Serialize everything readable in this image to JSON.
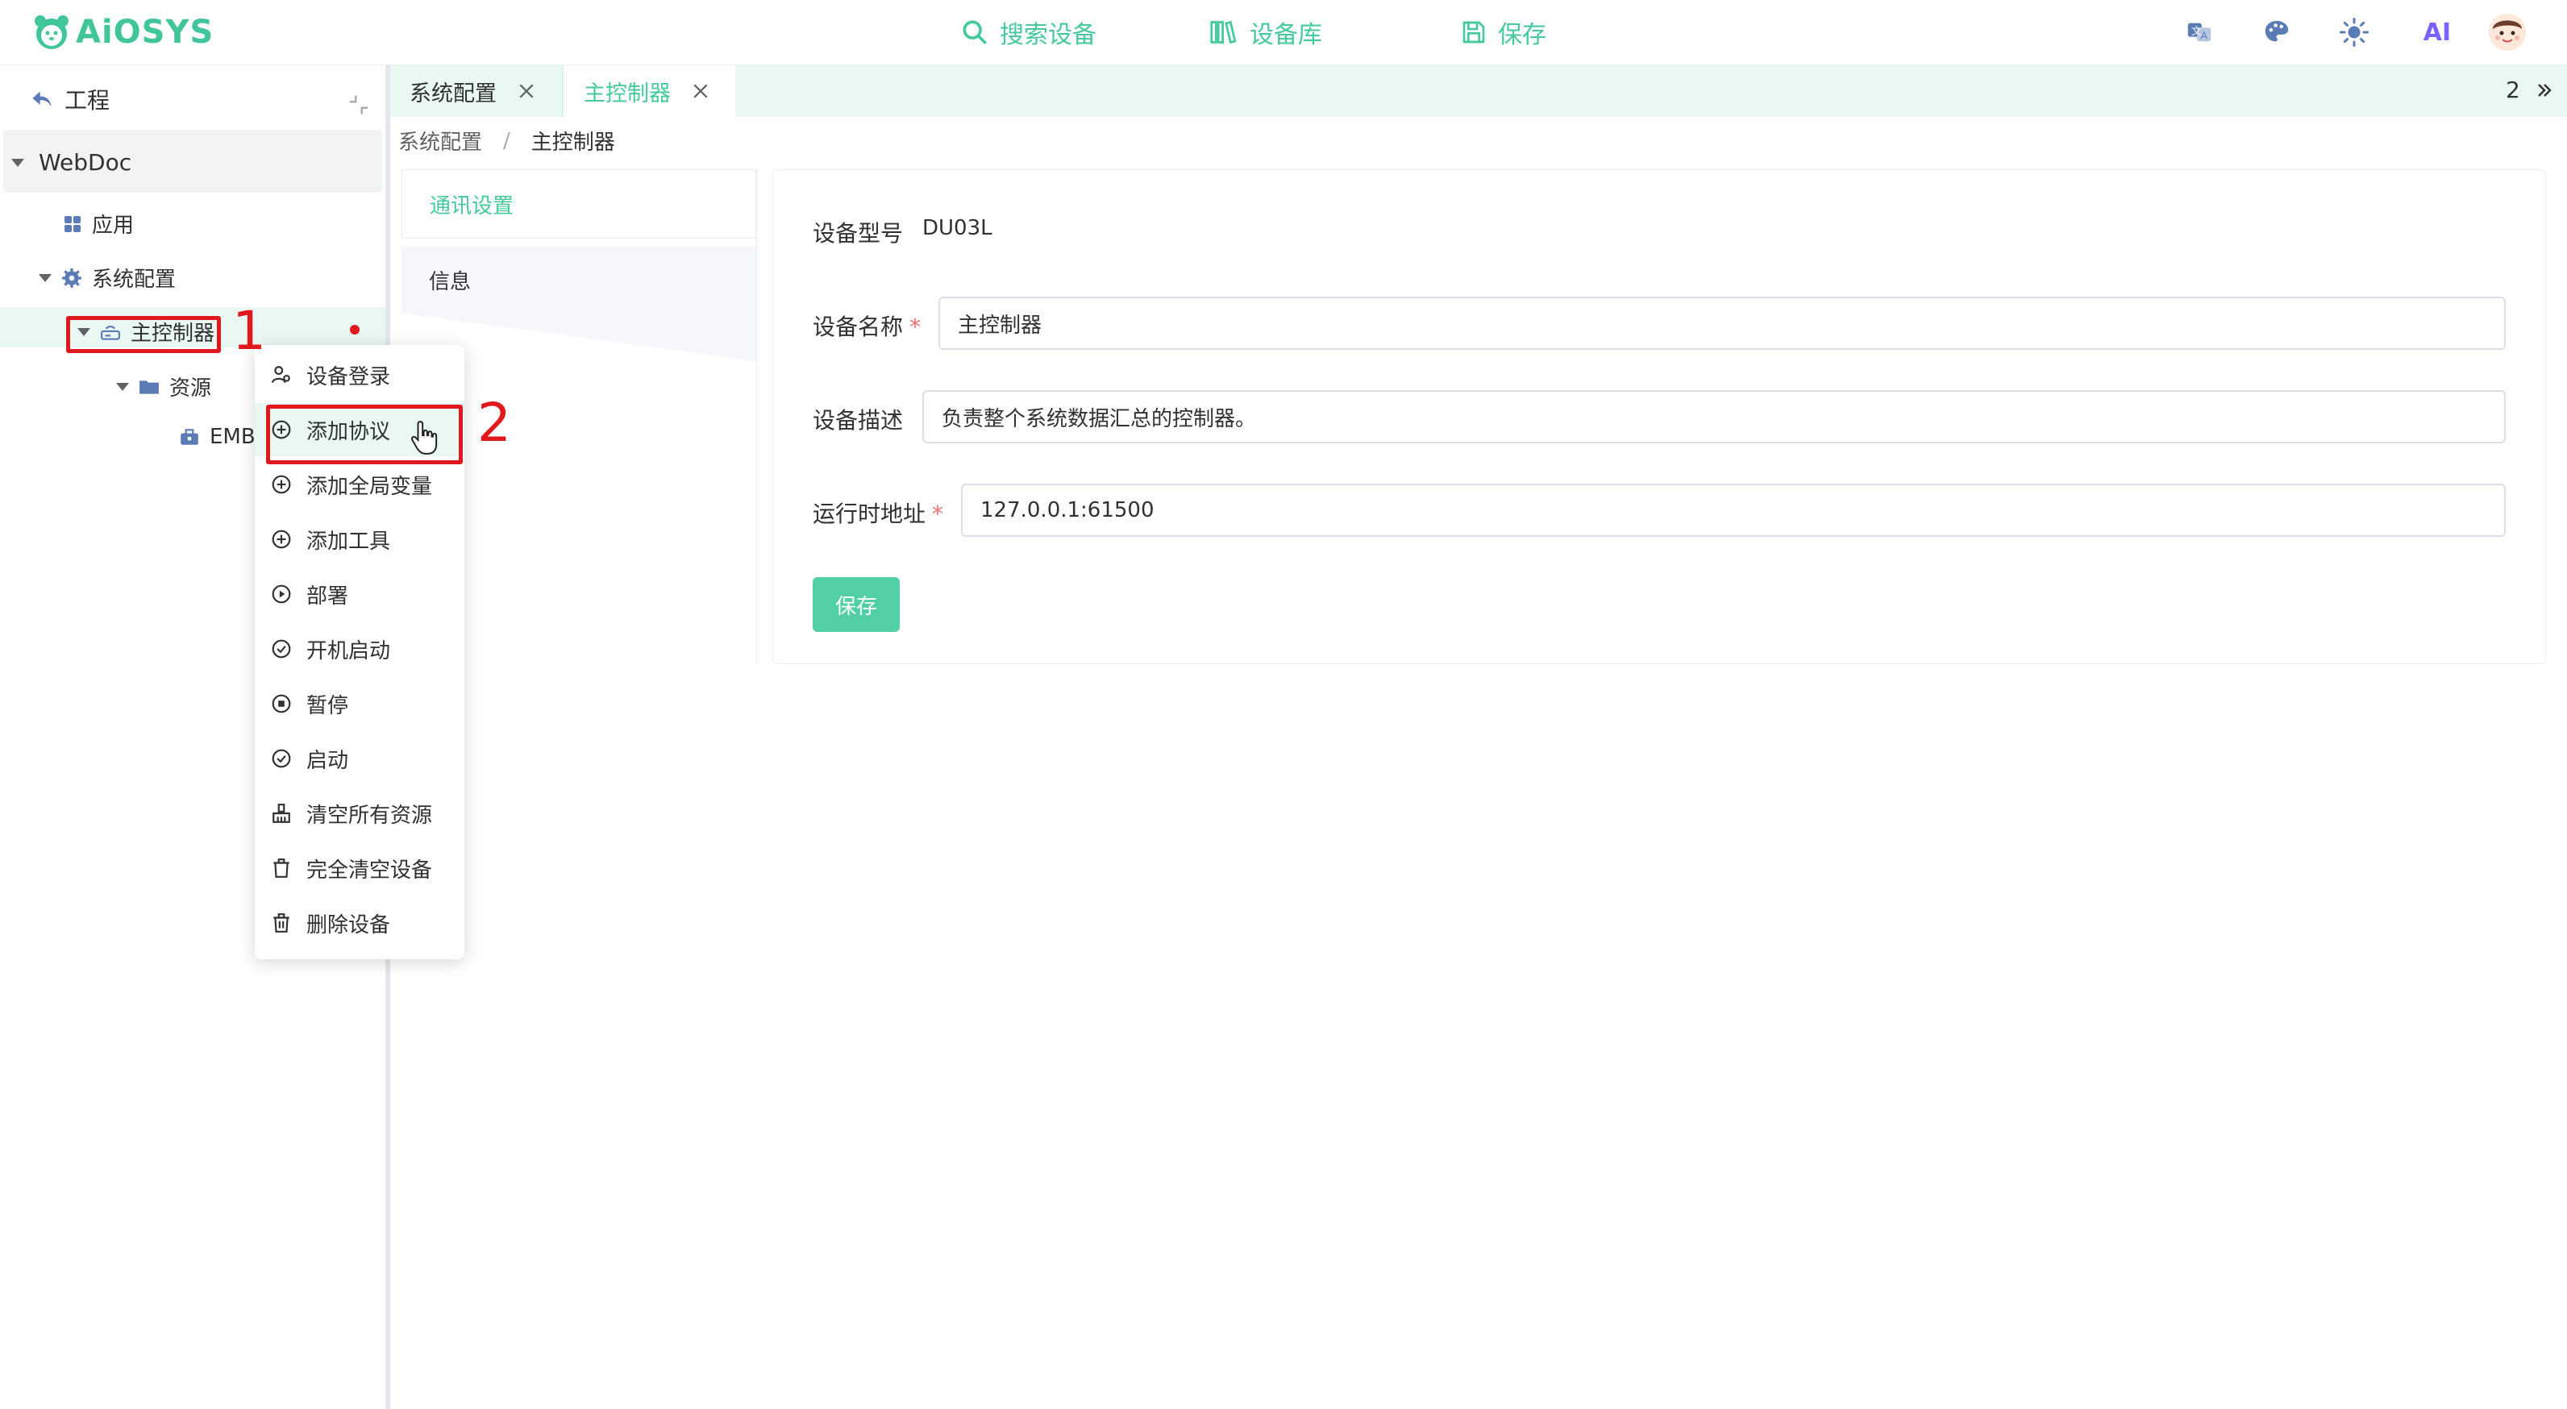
{
  "header": {
    "logo_text": "AiOSYS",
    "nav": [
      {
        "label": "搜索设备",
        "icon": "search-icon"
      },
      {
        "label": "设备库",
        "icon": "library-icon"
      },
      {
        "label": "保存",
        "icon": "save-icon"
      }
    ],
    "right_icons": [
      "translate-icon",
      "palette-icon",
      "sun-icon",
      "ai-icon",
      "avatar"
    ],
    "ai_label": "AI",
    "accent_color": "#46c99c"
  },
  "sidebar": {
    "back_label": "工程",
    "root": "WebDoc",
    "items": [
      {
        "label": "应用",
        "icon": "grid-icon"
      },
      {
        "label": "系统配置",
        "icon": "gear-icon"
      },
      {
        "label": "主控制器",
        "icon": "router-icon"
      },
      {
        "label": "资源",
        "icon": "folder-icon"
      },
      {
        "label": "EMB",
        "icon": "toolbox-icon"
      }
    ]
  },
  "tabs": {
    "items": [
      {
        "label": "系统配置",
        "active": false
      },
      {
        "label": "主控制器",
        "active": true
      }
    ],
    "count": "2"
  },
  "breadcrumb": {
    "items": [
      "系统配置",
      "主控制器"
    ],
    "separator": "/"
  },
  "inner_nav": {
    "items": [
      "通讯设置",
      "信息"
    ]
  },
  "form": {
    "model_label": "设备型号",
    "model_value": "DU03L",
    "name_label": "设备名称",
    "name_value": "主控制器",
    "desc_label": "设备描述",
    "desc_value": "负责整个系统数据汇总的控制器。",
    "addr_label": "运行时地址",
    "addr_value": "127.0.0.1:61500",
    "required_mark": "*",
    "save_label": "保存"
  },
  "context_menu": {
    "items": [
      {
        "label": "设备登录",
        "icon": "login-icon"
      },
      {
        "label": "添加协议",
        "icon": "plus-circle-icon"
      },
      {
        "label": "添加全局变量",
        "icon": "plus-circle-icon"
      },
      {
        "label": "添加工具",
        "icon": "plus-circle-icon"
      },
      {
        "label": "部署",
        "icon": "play-circle-icon"
      },
      {
        "label": "开机启动",
        "icon": "check-circle-icon"
      },
      {
        "label": "暂停",
        "icon": "stop-circle-icon"
      },
      {
        "label": "启动",
        "icon": "check-circle-icon"
      },
      {
        "label": "清空所有资源",
        "icon": "broom-icon"
      },
      {
        "label": "完全清空设备",
        "icon": "trash-icon"
      },
      {
        "label": "删除设备",
        "icon": "trash-icon"
      }
    ]
  },
  "annotations": {
    "step1": "1",
    "step2": "2"
  }
}
